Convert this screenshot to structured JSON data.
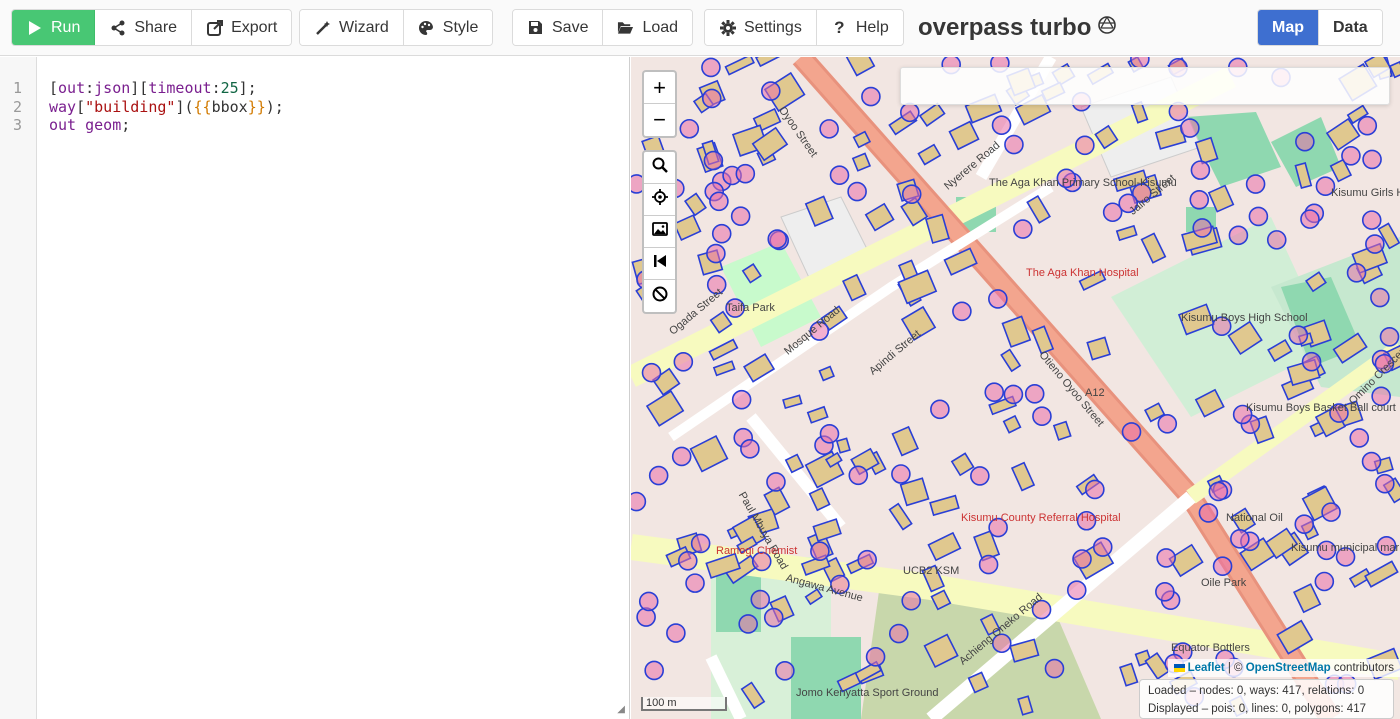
{
  "toolbar": {
    "run_label": "Run",
    "share_label": "Share",
    "export_label": "Export",
    "wizard_label": "Wizard",
    "style_label": "Style",
    "save_label": "Save",
    "load_label": "Load",
    "settings_label": "Settings",
    "help_label": "Help",
    "title": "overpass turbo",
    "map_label": "Map",
    "data_label": "Data"
  },
  "editor": {
    "line_numbers": [
      "1",
      "2",
      "3"
    ],
    "lines": [
      [
        {
          "t": "[",
          "c": "plain"
        },
        {
          "t": "out",
          "c": "key"
        },
        {
          "t": ":",
          "c": "plain"
        },
        {
          "t": "json",
          "c": "key"
        },
        {
          "t": "][",
          "c": "plain"
        },
        {
          "t": "timeout",
          "c": "key"
        },
        {
          "t": ":",
          "c": "plain"
        },
        {
          "t": "25",
          "c": "num"
        },
        {
          "t": "];",
          "c": "plain"
        }
      ],
      [
        {
          "t": "way",
          "c": "kw"
        },
        {
          "t": "[",
          "c": "plain"
        },
        {
          "t": "\"building\"",
          "c": "str"
        },
        {
          "t": "](",
          "c": "plain"
        },
        {
          "t": "{{",
          "c": "tpl"
        },
        {
          "t": "bbox",
          "c": "plain"
        },
        {
          "t": "}}",
          "c": "tpl"
        },
        {
          "t": ");",
          "c": "plain"
        }
      ],
      [
        {
          "t": "out",
          "c": "kw"
        },
        {
          "t": " ",
          "c": "plain"
        },
        {
          "t": "geom",
          "c": "key"
        },
        {
          "t": ";",
          "c": "plain"
        }
      ]
    ]
  },
  "map": {
    "zoom_in": "+",
    "zoom_out": "−",
    "scale_label": "100 m",
    "attribution": {
      "leaflet": "Leaflet",
      "separator": " | © ",
      "osm": "OpenStreetMap",
      "suffix": " contributors"
    },
    "stats": {
      "loaded": "Loaded – nodes: 0, ways: 417, relations: 0",
      "displayed": "Displayed – pois: 0, lines: 0, polygons: 417"
    },
    "labels": [
      "Oyoo Street",
      "Nyerere Road",
      "Jairo Street",
      "The Aga Khan Primary School-Kisumu",
      "Kisumu Girls High School",
      "Ogada Street",
      "Taifa Park",
      "Mosque Road",
      "Apindi Street",
      "The Aga Khan Hospital",
      "Otieno Oyoo Street",
      "Kisumu Boys High School",
      "Omino Crescent",
      "Paul Mbuya Road",
      "Kisumu Boys Basket Ball court",
      "A12",
      "National Oil",
      "Ramogi Chemist",
      "Angawa Avenue",
      "UCB2 KSM",
      "Kisumu County Referral Hospital",
      "Kisumu municipal market",
      "Oile Park",
      "Jomo Kenyatta Sport Ground",
      "Achieng Oneko Road",
      "Equator Bottlers"
    ]
  }
}
